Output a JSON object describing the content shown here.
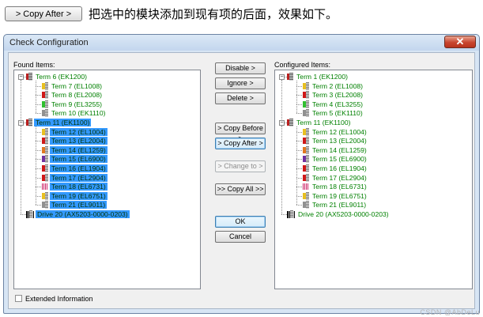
{
  "caption": {
    "button_label": "> Copy After >",
    "text": "把选中的模块添加到现有项的后面，效果如下。"
  },
  "window": {
    "title": "Check Configuration",
    "close_glyph": "✕"
  },
  "found": {
    "label": "Found Items:",
    "nodes": [
      {
        "id": "f0",
        "text": "Term 6 (EK1200)",
        "icon": "coupler",
        "level": 0,
        "expander": "−",
        "sel": false
      },
      {
        "id": "f1",
        "text": "Term 7 (EL1008)",
        "icon": "c-yellow",
        "level": 1,
        "sel": false
      },
      {
        "id": "f2",
        "text": "Term 8 (EL2008)",
        "icon": "c-red",
        "level": 1,
        "sel": false
      },
      {
        "id": "f3",
        "text": "Term 9 (EL3255)",
        "icon": "c-green",
        "level": 1,
        "sel": false
      },
      {
        "id": "f4",
        "text": "Term 10 (EK1110)",
        "icon": "c-gray",
        "level": 1,
        "sel": false
      },
      {
        "id": "f5",
        "text": "Term 11 (EK1100)",
        "icon": "coupler",
        "level": 0,
        "expander": "−",
        "sel": true
      },
      {
        "id": "f6",
        "text": "Term 12 (EL1004)",
        "icon": "c-yellow",
        "level": 1,
        "sel": true
      },
      {
        "id": "f7",
        "text": "Term 13 (EL2004)",
        "icon": "c-red",
        "level": 1,
        "sel": true
      },
      {
        "id": "f8",
        "text": "Term 14 (EL1259)",
        "icon": "c-orange",
        "level": 1,
        "sel": true
      },
      {
        "id": "f9",
        "text": "Term 15 (EL6900)",
        "icon": "c-purple",
        "level": 1,
        "sel": true
      },
      {
        "id": "f10",
        "text": "Term 16 (EL1904)",
        "icon": "c-red",
        "level": 1,
        "sel": true
      },
      {
        "id": "f11",
        "text": "Term 17 (EL2904)",
        "icon": "c-red",
        "level": 1,
        "sel": true
      },
      {
        "id": "f12",
        "text": "Term 18 (EL6731)",
        "icon": "mesh",
        "level": 1,
        "sel": true
      },
      {
        "id": "f13",
        "text": "Term 19 (EL6751)",
        "icon": "c-yellow",
        "level": 1,
        "sel": true
      },
      {
        "id": "f14",
        "text": "Term 21 (EL9011)",
        "icon": "c-gray",
        "level": 1,
        "sel": true
      },
      {
        "id": "f15",
        "text": "Drive 20 (AX5203-0000-0203)",
        "icon": "drive",
        "level": 0,
        "sel": true
      }
    ]
  },
  "configured": {
    "label": "Configured Items:",
    "nodes": [
      {
        "id": "c0",
        "text": "Term 1 (EK1200)",
        "icon": "coupler",
        "level": 0,
        "expander": "−"
      },
      {
        "id": "c1",
        "text": "Term 2 (EL1008)",
        "icon": "c-yellow",
        "level": 1
      },
      {
        "id": "c2",
        "text": "Term 3 (EL2008)",
        "icon": "c-red",
        "level": 1
      },
      {
        "id": "c3",
        "text": "Term 4 (EL3255)",
        "icon": "c-green",
        "level": 1
      },
      {
        "id": "c4",
        "text": "Term 5 (EK1110)",
        "icon": "c-gray",
        "level": 1
      },
      {
        "id": "c5",
        "text": "Term 11 (EK1100)",
        "icon": "coupler",
        "level": 0,
        "expander": "−"
      },
      {
        "id": "c6",
        "text": "Term 12 (EL1004)",
        "icon": "c-yellow",
        "level": 1
      },
      {
        "id": "c7",
        "text": "Term 13 (EL2004)",
        "icon": "c-red",
        "level": 1
      },
      {
        "id": "c8",
        "text": "Term 14 (EL1259)",
        "icon": "c-orange",
        "level": 1
      },
      {
        "id": "c9",
        "text": "Term 15 (EL6900)",
        "icon": "c-purple",
        "level": 1
      },
      {
        "id": "c10",
        "text": "Term 16 (EL1904)",
        "icon": "c-red",
        "level": 1
      },
      {
        "id": "c11",
        "text": "Term 17 (EL2904)",
        "icon": "c-red",
        "level": 1
      },
      {
        "id": "c12",
        "text": "Term 18 (EL6731)",
        "icon": "mesh",
        "level": 1
      },
      {
        "id": "c13",
        "text": "Term 19 (EL6751)",
        "icon": "c-yellow",
        "level": 1
      },
      {
        "id": "c14",
        "text": "Term 21 (EL9011)",
        "icon": "c-gray",
        "level": 1
      },
      {
        "id": "c15",
        "text": "Drive 20 (AX5203-0000-0203)",
        "icon": "drive",
        "level": 0
      }
    ]
  },
  "buttons": {
    "disable": "Disable >",
    "ignore": "Ignore >",
    "delete": "Delete >",
    "copy_before": "> Copy Before >",
    "copy_after": "> Copy After >",
    "change_to": "> Change to >",
    "copy_all": ">> Copy All >>",
    "ok": "OK",
    "cancel": "Cancel"
  },
  "extended_info": {
    "label": "Extended Information",
    "checked": false
  },
  "watermark": "CSDN @AbDeLu",
  "colors": {
    "node_text": "#008000",
    "selection": "#3399ff",
    "c-yellow": "#e8c020",
    "c-red": "#d01818",
    "c-green": "#30c030",
    "c-gray": "#909090",
    "c-orange": "#e07820",
    "c-purple": "#7030a0"
  }
}
